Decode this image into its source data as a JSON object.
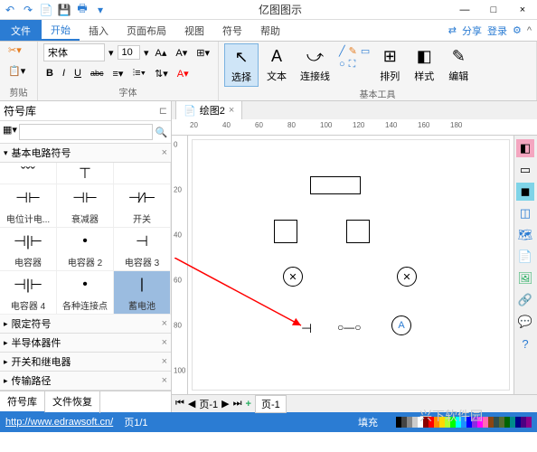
{
  "app_title": "亿图图示",
  "qat": [
    "undo-icon",
    "redo-icon",
    "file-icon",
    "save-icon",
    "print-icon",
    "new-icon"
  ],
  "win": {
    "min": "—",
    "max": "□",
    "close": "×"
  },
  "menu": {
    "file": "文件",
    "items": [
      "开始",
      "插入",
      "页面布局",
      "视图",
      "符号",
      "帮助"
    ],
    "active": 0,
    "share": "分享",
    "login": "登录"
  },
  "ribbon": {
    "clipboard": {
      "label": "剪贴",
      "cut": "✂"
    },
    "font": {
      "label": "字体",
      "family": "宋体",
      "size": "10",
      "bold": "B",
      "italic": "I",
      "underline": "U",
      "strike": "abc"
    },
    "tools": {
      "label": "基本工具",
      "select": "选择",
      "text": "文本",
      "connector": "连接线",
      "arrange": "排列",
      "style": "样式",
      "edit": "编辑"
    }
  },
  "symlib": {
    "title": "符号库",
    "search_placeholder": "",
    "categories": [
      {
        "name": "基本电路符号",
        "open": true
      },
      {
        "name": "限定符号",
        "open": false
      },
      {
        "name": "半导体器件",
        "open": false
      },
      {
        "name": "开关和继电器",
        "open": false
      },
      {
        "name": "传输路径",
        "open": false
      }
    ],
    "symbols_row1": [
      "ˇˇˇ",
      "⊤",
      ""
    ],
    "symbols": [
      {
        "label": "电位计电...",
        "icon": "⊣⊢"
      },
      {
        "label": "衰减器",
        "icon": "⊣⊢"
      },
      {
        "label": "开关",
        "icon": "⊣∕⊢"
      },
      {
        "label": "电容器",
        "icon": "⊣|⊢"
      },
      {
        "label": "电容器 2",
        "icon": "•"
      },
      {
        "label": "电容器 3",
        "icon": "⊣"
      },
      {
        "label": "电容器 4",
        "icon": "⊣|⊢"
      },
      {
        "label": "各种连接点",
        "icon": "•"
      },
      {
        "label": "蓄电池",
        "icon": "|",
        "selected": true
      }
    ],
    "tabs": [
      "符号库",
      "文件恢复"
    ],
    "active_tab": 0
  },
  "doc_tab": {
    "name": "绘图2",
    "icon": "📄"
  },
  "ruler_h": [
    20,
    40,
    60,
    80,
    100,
    120,
    140,
    160,
    180
  ],
  "ruler_v": [
    0,
    20,
    40,
    60,
    80,
    100
  ],
  "pages": {
    "nav": "页-1",
    "plus": "+",
    "tab": "页-1"
  },
  "status": {
    "url": "http://www.edrawsoft.cn/",
    "page": "页1/1",
    "fill": "填充"
  },
  "palette": [
    "#000",
    "#444",
    "#888",
    "#ccc",
    "#fff",
    "#8b0000",
    "#f00",
    "#ff8c00",
    "#ffd700",
    "#adff2f",
    "#0f0",
    "#0ff",
    "#1e90ff",
    "#00f",
    "#8a2be2",
    "#f0f",
    "#ff69b4",
    "#8b4513",
    "#2f4f4f",
    "#556b2f",
    "#006400",
    "#008b8b",
    "#00008b",
    "#4b0082",
    "#8b008b"
  ],
  "watermark": "兴下软件园"
}
